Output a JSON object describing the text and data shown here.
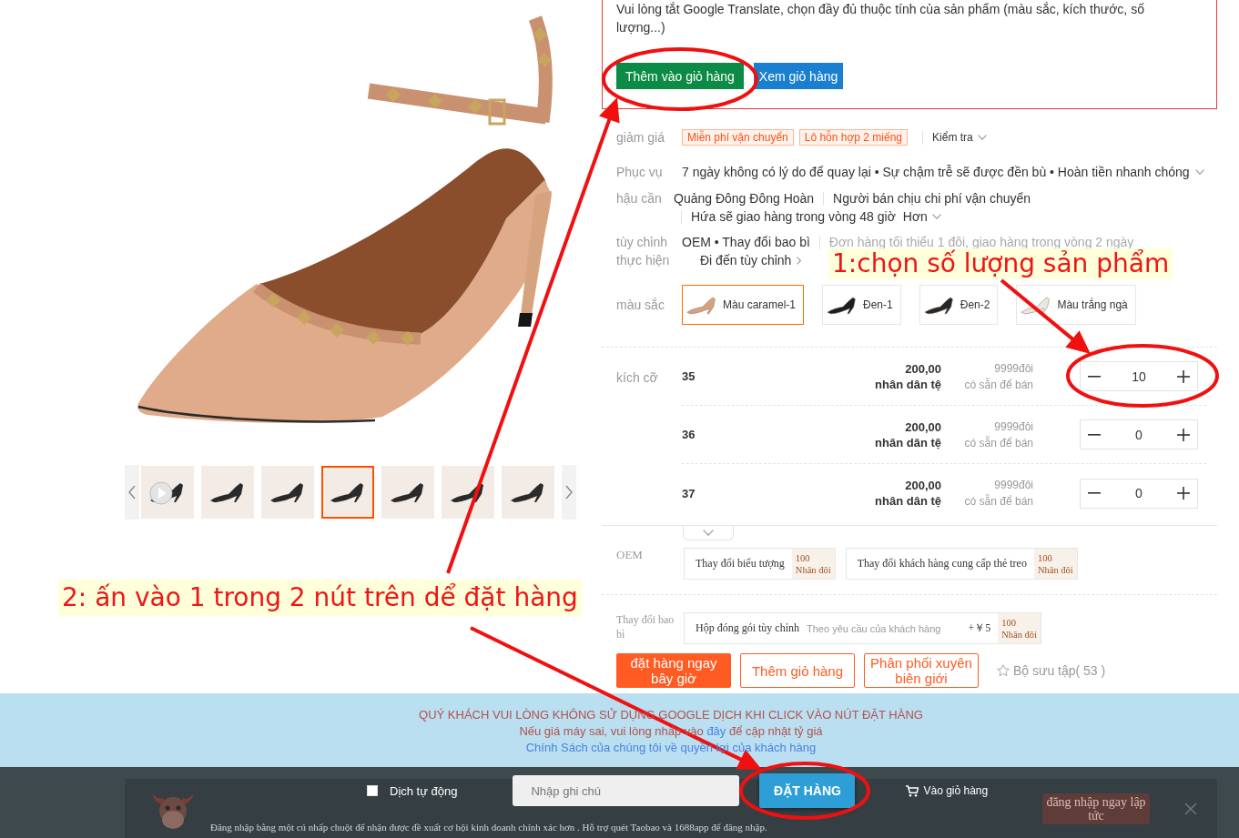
{
  "gallery": {
    "thumbnails": [
      {
        "kind": "video",
        "selected": false
      },
      {
        "kind": "image",
        "selected": false
      },
      {
        "kind": "image",
        "selected": false
      },
      {
        "kind": "image",
        "selected": true
      },
      {
        "kind": "image",
        "selected": false
      },
      {
        "kind": "image",
        "selected": false
      },
      {
        "kind": "image",
        "selected": false
      }
    ]
  },
  "step_notes": [
    "1:chọn số lượng sản phẩm",
    "2: ấn vào 1 trong 2 nút trên dể đặt hàng"
  ],
  "notice_box": {
    "message": "Vui lòng tắt Google Translate, chọn đầy đủ thuộc tính của sản phẩm (màu sắc, kích thước, số lượng...)",
    "buttons": [
      {
        "label": "Thêm vào giỏ hàng",
        "kind": "add"
      },
      {
        "label": "Xem giỏ hàng",
        "kind": "view"
      }
    ]
  },
  "discount": {
    "label": "giảm giá",
    "tags": [
      "Miễn phí vận chuyển",
      "Lô hỗn hợp 2 miếng"
    ],
    "link": "Kiểm tra"
  },
  "service": {
    "label": "Phục vụ",
    "text": "7 ngày không có lý do để quay lại • Sự chậm trễ sẽ được đền bù • Hoàn tiền nhanh chóng"
  },
  "logistics": {
    "label": "hậu cần",
    "origin": "Quảng Đông Đông Hoàn",
    "fee": "Người bán chịu chi phí vận chuyển",
    "promise": "Hứa sẽ giao hàng trong vòng 48 giờ",
    "more": "Hơn"
  },
  "customization": {
    "label": "tùy chỉnh thực hiện",
    "options": "OEM • Thay đổi bao bì",
    "note": "Đơn hàng tối thiểu 1 đôi, giao hàng trong vòng 2 ngày",
    "link": "Đi đến tùy chỉnh"
  },
  "colors": {
    "label": "màu sắc",
    "options": [
      {
        "name": "Màu caramel-1",
        "color": "#d9a07c",
        "selected": true
      },
      {
        "name": "Đen-1",
        "color": "#1e1e1e",
        "selected": false
      },
      {
        "name": "Đen-2",
        "color": "#2b2622",
        "selected": false
      },
      {
        "name": "Màu trắng ngà",
        "color": "#ebe7de",
        "selected": false
      }
    ]
  },
  "sizes": {
    "label": "kích cỡ",
    "rows": [
      {
        "size": "35",
        "price": "200,00",
        "currency": "nhân dân tệ",
        "stock": "9999đôi",
        "stock_note": "có sẵn để bán",
        "quantity": "10"
      },
      {
        "size": "36",
        "price": "200,00",
        "currency": "nhân dân tệ",
        "stock": "9999đôi",
        "stock_note": "có sẵn để bán",
        "quantity": "0"
      },
      {
        "size": "37",
        "price": "200,00",
        "currency": "nhân dân tệ",
        "stock": "9999đôi",
        "stock_note": "có sẵn để bán",
        "quantity": "0"
      }
    ]
  },
  "oem": {
    "label": "OEM",
    "options": [
      {
        "name": "Thay đổi biểu tượng",
        "min_qty": "100",
        "unit": "Nhân đôi"
      },
      {
        "name": "Thay đổi khách hàng cung cấp thẻ treo",
        "min_qty": "100",
        "unit": "Nhân đôi"
      }
    ]
  },
  "packaging": {
    "label": "Thay đổi bao bì",
    "options": [
      {
        "name": "Hộp đóng gói tùy chỉnh",
        "note": "Theo yêu cầu của khách hàng",
        "price": "+￥5",
        "min_qty": "100",
        "unit": "Nhân đôi"
      }
    ]
  },
  "actions": [
    {
      "label": "đặt hàng ngay bây giờ",
      "kind": "primary"
    },
    {
      "label": "Thêm giỏ hàng",
      "kind": "outline"
    },
    {
      "label": "Phân phối xuyên biên giới",
      "kind": "outline"
    }
  ],
  "favorite": {
    "label": "Bộ sưu tập( 53 )"
  },
  "notice_banner": {
    "warning": "QUÝ KHÁCH VUI LÒNG KHÔNG SỬ DỤNG GOOGLE DỊCH KHI CLICK VÀO NÚT ĐẶT HÀNG",
    "rate_before": "Nếu giá máy sai, vui lòng nhấp vào",
    "rate_link": "đây",
    "rate_after": "để cập nhật tỷ giá",
    "policy_link": "Chính Sách của chúng tôi về quyền lợi của khách hàng"
  },
  "order_bar": {
    "auto_translate": {
      "label": "Dịch tự động",
      "checked": false
    },
    "note": {
      "placeholder": "Nhập ghi chú"
    },
    "order_button": "ĐẶT HÀNG",
    "cart_link": "Vào giỏ hàng"
  },
  "login_prompt": {
    "message": "Đăng nhập bằng một cú nhấp chuột để nhận được đề xuất cơ hội kinh doanh chính xác hơn . Hỗ trợ quét Taobao và 1688app để đăng nhập.",
    "button": "đăng nhập ngay lập tức"
  }
}
